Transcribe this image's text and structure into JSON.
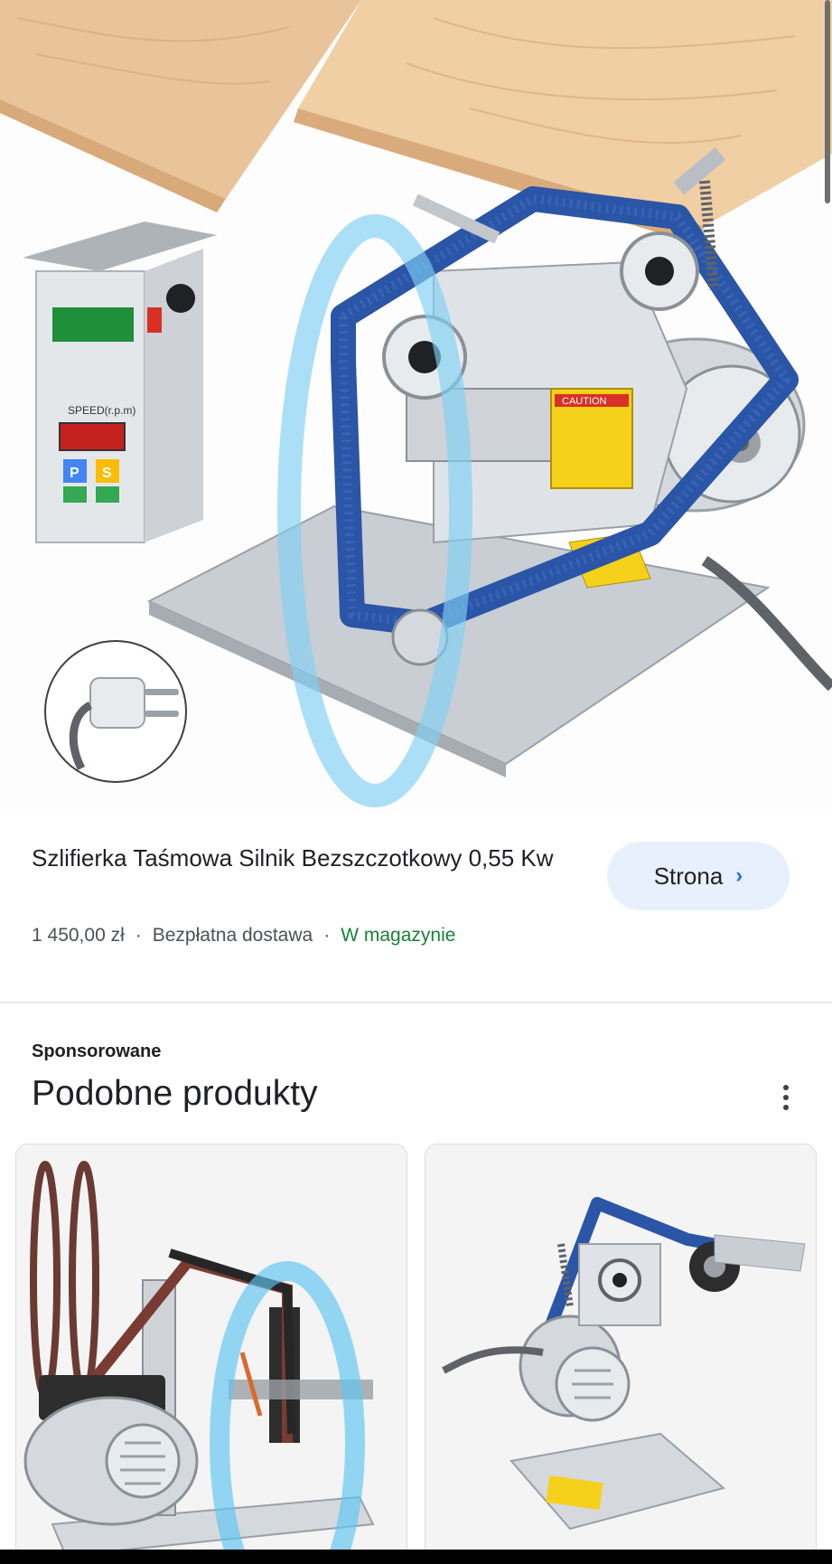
{
  "product": {
    "title": "Szlifierka Taśmowa Silnik Bezszczotkowy 0,55 Kw",
    "price": "1 450,00 zł",
    "separator": "·",
    "shipping": "Bezpłatna dostawa",
    "stock": "W magazynie",
    "store_button_label": "Strona",
    "store_button_icon": "chevron-right-icon"
  },
  "image_text": {
    "speed_label": "SPEED(r.p.m)",
    "p_key": "P",
    "s_key": "S",
    "caution": "CAUTION"
  },
  "related": {
    "sponsored_label": "Sponsorowane",
    "title": "Podobne produkty",
    "menu_icon": "more-vert-icon",
    "items": [
      {
        "image": "belt-grinder-red-belt-image"
      },
      {
        "image": "belt-grinder-blue-belt-image"
      }
    ]
  },
  "colors": {
    "stock_green": "#188038",
    "button_bg": "#e8f0fe",
    "chevron_blue": "#1a73e8"
  }
}
